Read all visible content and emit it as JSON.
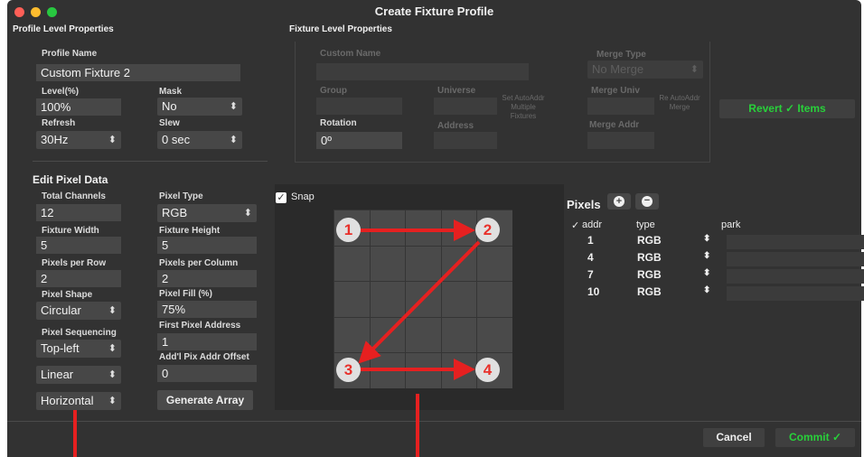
{
  "window": {
    "title": "Create Fixture Profile",
    "traffic_colors": {
      "close": "#ff5f57",
      "minimize": "#febc2e",
      "zoom": "#28c840"
    }
  },
  "profile": {
    "section_title": "Profile Level Properties",
    "name_label": "Profile Name",
    "name_value": "Custom Fixture 2",
    "level_label": "Level(%)",
    "level_value": "100%",
    "mask_label": "Mask",
    "mask_value": "No",
    "refresh_label": "Refresh",
    "refresh_value": "30Hz",
    "slew_label": "Slew",
    "slew_value": "0 sec"
  },
  "fixture": {
    "section_title": "Fixture Level Properties",
    "custom_name_label": "Custom Name",
    "merge_type_label": "Merge Type",
    "merge_type_value": "No Merge",
    "group_label": "Group",
    "universe_label": "Universe",
    "set_autoaddr_label": "Set AutoAddr Multiple Fixtures",
    "merge_univ_label": "Merge Univ",
    "re_autoaddr_label": "Re AutoAddr Merge",
    "rotation_label": "Rotation",
    "rotation_value": "0º",
    "address_label": "Address",
    "merge_addr_label": "Merge Addr",
    "revert_label": "Revert ✓ Items"
  },
  "pixel_edit": {
    "section_title": "Edit Pixel Data",
    "total_channels_label": "Total Channels",
    "total_channels_value": "12",
    "pixel_type_label": "Pixel Type",
    "pixel_type_value": "RGB",
    "fixture_width_label": "Fixture Width",
    "fixture_width_value": "5",
    "fixture_height_label": "Fixture Height",
    "fixture_height_value": "5",
    "pixels_per_row_label": "Pixels per Row",
    "pixels_per_row_value": "2",
    "pixels_per_column_label": "Pixels per Column",
    "pixels_per_column_value": "2",
    "pixel_shape_label": "Pixel Shape",
    "pixel_shape_value": "Circular",
    "pixel_fill_label": "Pixel Fill (%)",
    "pixel_fill_value": "75%",
    "pixel_sequencing_label": "Pixel Sequencing",
    "pixel_sequencing_value": "Top-left",
    "first_pixel_address_label": "First Pixel Address",
    "first_pixel_address_value": "1",
    "sequencing_mode_value": "Linear",
    "addl_offset_label": "Add'l Pix Addr Offset",
    "addl_offset_value": "0",
    "orientation_value": "Horizontal",
    "generate_label": "Generate Array"
  },
  "preview": {
    "snap_label": "Snap",
    "markers": [
      "1",
      "2",
      "3",
      "4"
    ]
  },
  "pixels": {
    "title": "Pixels",
    "col_check": "✓",
    "col_addr": "addr",
    "col_type": "type",
    "col_park": "park",
    "rows": [
      {
        "addr": "1",
        "type": "RGB"
      },
      {
        "addr": "4",
        "type": "RGB"
      },
      {
        "addr": "7",
        "type": "RGB"
      },
      {
        "addr": "10",
        "type": "RGB"
      }
    ]
  },
  "footer": {
    "cancel_label": "Cancel",
    "commit_label": "Commit ✓"
  },
  "colors": {
    "window_bg": "#323232",
    "field_bg": "#474747",
    "accent_green": "#28d13a",
    "annotation_red": "#e62020"
  }
}
